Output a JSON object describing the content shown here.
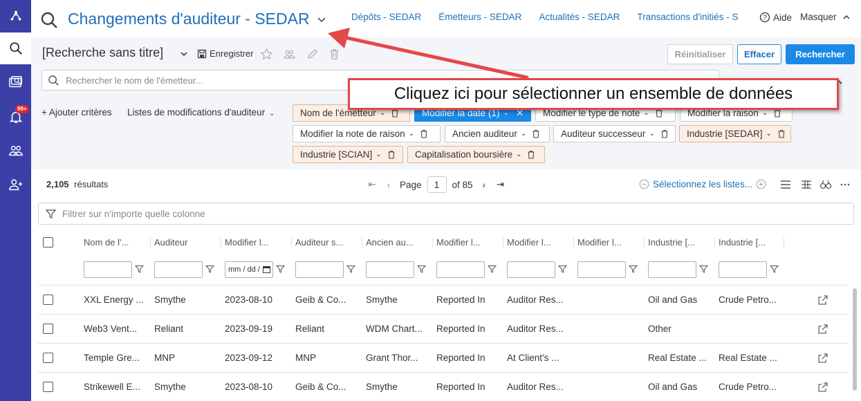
{
  "nav": {
    "badge": "99+"
  },
  "header": {
    "title": "Changements d'auditeur - SEDAR",
    "links": [
      "Dépôts - SEDAR",
      "Émetteurs - SEDAR",
      "Actualités - SEDAR",
      "Transactions d'initiés - S"
    ],
    "help": "Aide",
    "hide": "Masquer"
  },
  "toolbar": {
    "search_name": "[Recherche sans titre]",
    "save": "Enregistrer",
    "reset": "Réinitialiser",
    "clear": "Effacer",
    "search": "Rechercher"
  },
  "issuer_search": {
    "placeholder": "Rechercher le nom de l'émetteur..."
  },
  "criteria": {
    "add": "+ Ajouter critères",
    "lists": "Listes de modifications d'auditeur",
    "chips": [
      "Nom de l'émetteur",
      "Modifier la date (1)",
      "Modifier le type de note",
      "Modifier la raison",
      "Modifier la note de raison",
      "Ancien auditeur",
      "Auditeur successeur",
      "Industrie [SEDAR]",
      "Industrie [SCIAN]",
      "Capitalisation boursière"
    ]
  },
  "callout": "Cliquez ici pour sélectionner un ensemble de données",
  "results": {
    "count": "2,105",
    "label": "résultats",
    "page_label": "Page",
    "page": "1",
    "of": "of 85",
    "select_lists": "Sélectionnez les listes...",
    "filter_placeholder": "Filtrer sur n'importe quelle colonne"
  },
  "grid": {
    "headers": [
      "Nom de l'...",
      "Auditeur",
      "Modifier l...",
      "Auditeur s...",
      "Ancien au...",
      "Modifier l...",
      "Modifier l...",
      "Modifier l...",
      "Industrie [...",
      "Industrie [..."
    ],
    "date_placeholder": "mm / dd / ",
    "rows": [
      [
        "XXL Energy ...",
        "Smythe",
        "2023-08-10",
        "Geib & Co...",
        "Smythe",
        "Reported In",
        "Auditor Res...",
        "",
        "Oil and Gas",
        "Crude Petro..."
      ],
      [
        "Web3 Vent...",
        "Reliant",
        "2023-09-19",
        "Reliant",
        "WDM Chart...",
        "Reported In",
        "Auditor Res...",
        "",
        "Other",
        ""
      ],
      [
        "Temple Gre...",
        "MNP",
        "2023-09-12",
        "MNP",
        "Grant Thor...",
        "Reported In",
        "At Client's ...",
        "",
        "Real Estate ...",
        "Real Estate ..."
      ],
      [
        "Strikewell E...",
        "Smythe",
        "2023-08-10",
        "Geib & Co...",
        "Smythe",
        "Reported In",
        "Auditor Res...",
        "",
        "Oil and Gas",
        "Crude Petro..."
      ]
    ]
  },
  "colors": {
    "nav": "#3b3fa6",
    "link": "#1f6fb8",
    "primary": "#1a8ae6",
    "chip_bg": "#fdeee4",
    "callout_border": "#e5474a"
  }
}
